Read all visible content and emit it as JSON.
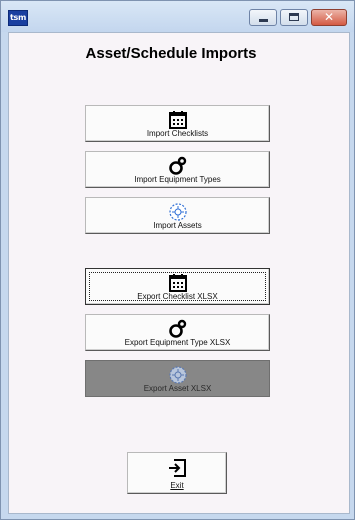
{
  "window": {
    "app_icon_text": "tsm",
    "close_glyph": "✕",
    "icons": {
      "minimize": "minimize-icon",
      "maximize": "maximize-icon",
      "close": "close-icon"
    }
  },
  "page": {
    "title": "Asset/Schedule Imports"
  },
  "import_buttons": [
    {
      "label": "Import Checklists",
      "icon": "calendar-icon"
    },
    {
      "label": "Import Equipment Types",
      "icon": "equipment-type-icon"
    },
    {
      "label": "Import Assets",
      "icon": "asset-icon"
    }
  ],
  "export_buttons": [
    {
      "label": "Export Checklist XLSX",
      "icon": "calendar-icon",
      "focused": true
    },
    {
      "label": "Export Equipment Type XLSX",
      "icon": "equipment-type-icon"
    },
    {
      "label": "Export Asset XLSX",
      "icon": "asset-icon",
      "disabled": true
    }
  ],
  "exit_button": {
    "label": "Exit",
    "icon": "exit-icon"
  },
  "colors": {
    "window_frame": "#c6d8ee",
    "client_background": "#f8f4f8",
    "disabled_button": "#878787",
    "close_button": "#d45a43"
  }
}
